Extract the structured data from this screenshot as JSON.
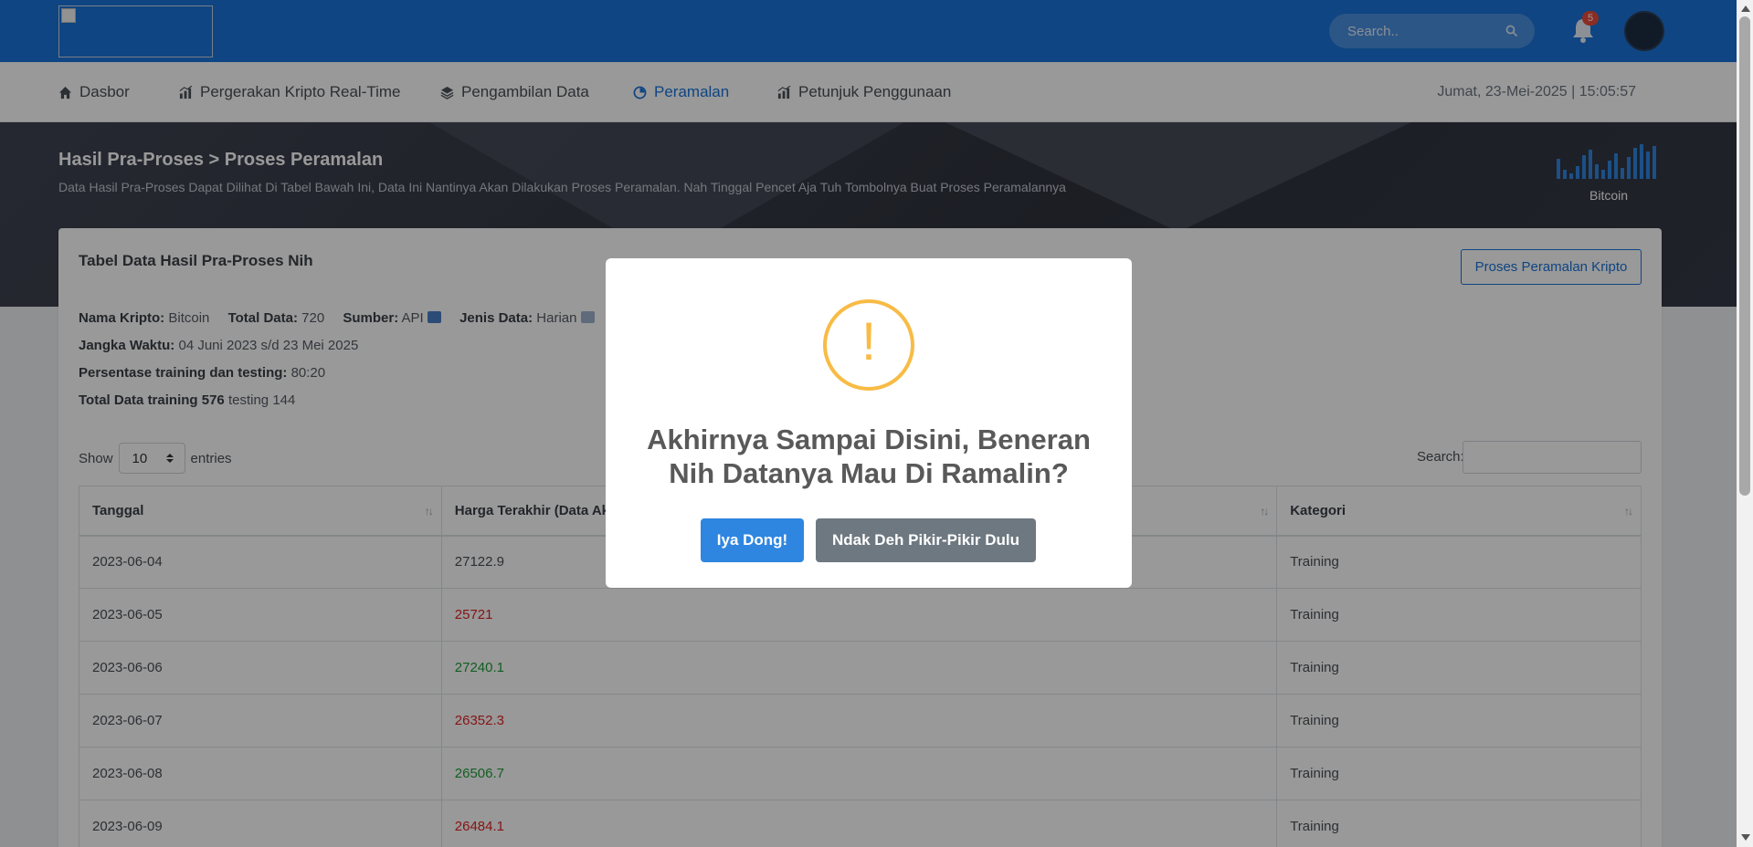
{
  "header": {
    "search_placeholder": "Search..",
    "notification_count": "5"
  },
  "nav": {
    "items": [
      {
        "label": "Dasbor",
        "icon": "home-icon"
      },
      {
        "label": "Pergerakan Kripto Real-Time",
        "icon": "chart-icon"
      },
      {
        "label": "Pengambilan Data",
        "icon": "layers-icon"
      },
      {
        "label": "Peramalan",
        "icon": "gauge-icon",
        "active": true
      },
      {
        "label": "Petunjuk Penggunaan",
        "icon": "chart-icon"
      }
    ],
    "datetime": "Jumat, 23-Mei-2025 | 15:05:57"
  },
  "hero": {
    "title": "Hasil Pra-Proses > Proses Peramalan",
    "subtitle": "Data Hasil Pra-Proses Dapat Dilihat Di Tabel Bawah Ini, Data Ini Nantinya Akan Dilakukan Proses Peramalan. Nah Tinggal Pencet Aja Tuh Tombolnya Buat Proses Peramalannya",
    "chart_label": "Bitcoin"
  },
  "card": {
    "title": "Tabel Data Hasil Pra-Proses Nih",
    "process_button": "Proses Peramalan Kripto",
    "info": {
      "nama_kripto_label": "Nama Kripto:",
      "nama_kripto": "Bitcoin",
      "total_data_label": "Total Data:",
      "total_data": "720",
      "sumber_label": "Sumber:",
      "sumber": "API",
      "jenis_data_label": "Jenis Data:",
      "jenis_data": "Harian",
      "jangka_waktu_label": "Jangka Waktu:",
      "jangka_waktu": "04 Juni 2023 s/d 23 Mei 2025",
      "persentase_label": "Persentase training dan testing:",
      "persentase": "80:20",
      "total_training_label": "Total Data training",
      "total_training": "576",
      "testing_label": "testing",
      "testing": "144"
    },
    "show_label": "Show",
    "entries_value": "10",
    "entries_label": "entries",
    "search_label": "Search:"
  },
  "table": {
    "columns": [
      "Tanggal",
      "Harga Terakhir (Data Aktual)",
      "Kategori"
    ],
    "rows": [
      {
        "tanggal": "2023-06-04",
        "harga": "27122.9",
        "trend": "neutral",
        "kategori": "Training"
      },
      {
        "tanggal": "2023-06-05",
        "harga": "25721",
        "trend": "down",
        "kategori": "Training"
      },
      {
        "tanggal": "2023-06-06",
        "harga": "27240.1",
        "trend": "up",
        "kategori": "Training"
      },
      {
        "tanggal": "2023-06-07",
        "harga": "26352.3",
        "trend": "down",
        "kategori": "Training"
      },
      {
        "tanggal": "2023-06-08",
        "harga": "26506.7",
        "trend": "up",
        "kategori": "Training"
      },
      {
        "tanggal": "2023-06-09",
        "harga": "26484.1",
        "trend": "down",
        "kategori": "Training"
      }
    ]
  },
  "modal": {
    "icon": "warning-icon",
    "title": "Akhirnya Sampai Disini, Beneran Nih Datanya Mau Di Ramalin?",
    "confirm": "Iya Dong!",
    "cancel": "Ndak Deh Pikir-Pikir Dulu"
  },
  "colors": {
    "primary": "#1a73d9",
    "warning": "#f8bb45",
    "down": "#e02424",
    "up": "#1e9e3a"
  }
}
